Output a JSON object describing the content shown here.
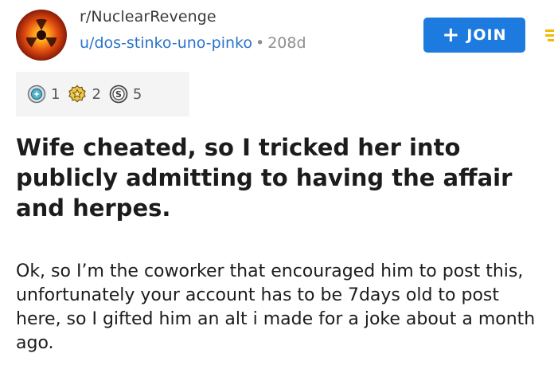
{
  "header": {
    "subreddit": "r/NuclearRevenge",
    "author": "u/dos-stinko-uno-pinko",
    "separator": "•",
    "age": "208d",
    "join_label": "JOIN",
    "join_icon": "plus-icon",
    "menu_icon": "menu-icon",
    "accent_color": "#1d7be0",
    "author_color": "#2a74c9",
    "menu_color": "#f5b800"
  },
  "awards": [
    {
      "icon": "silver-award-icon",
      "count": "1"
    },
    {
      "icon": "gold-award-icon",
      "count": "2"
    },
    {
      "icon": "platinum-award-icon",
      "count": "5"
    }
  ],
  "post": {
    "title": "Wife cheated, so I tricked her into publicly admitting to having the affair and herpes.",
    "body": "Ok, so I’m the coworker that encouraged him to post this, unfortunately your account has to be 7days old to post here, so I gifted him an alt i made for a joke about a month ago."
  }
}
